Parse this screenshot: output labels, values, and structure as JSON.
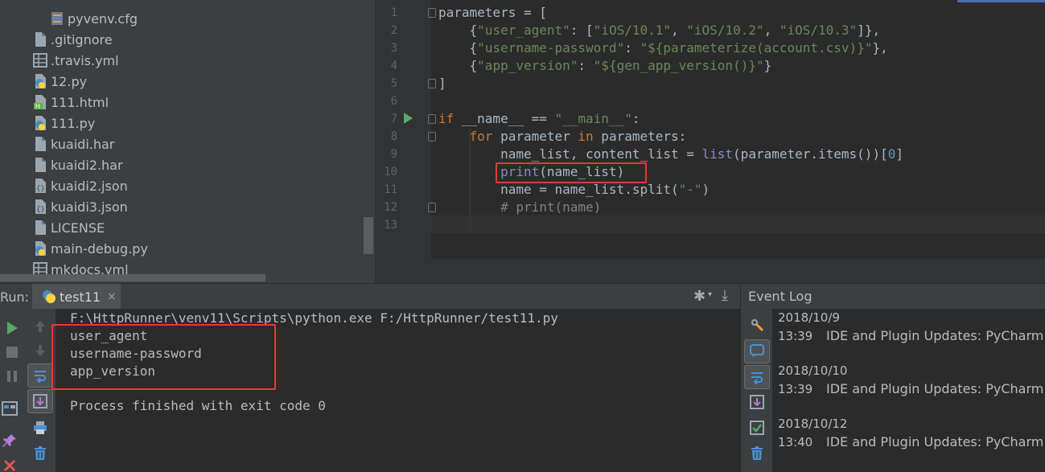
{
  "project_tree": {
    "items": [
      {
        "label": "pyvenv.cfg",
        "icon": "config-file-icon"
      },
      {
        "label": ".gitignore",
        "icon": "text-file-icon"
      },
      {
        "label": ".travis.yml",
        "icon": "yaml-file-icon"
      },
      {
        "label": "12.py",
        "icon": "python-file-icon"
      },
      {
        "label": "111.html",
        "icon": "html-file-icon"
      },
      {
        "label": "111.py",
        "icon": "python-file-icon"
      },
      {
        "label": "kuaidi.har",
        "icon": "text-file-icon"
      },
      {
        "label": "kuaidi2.har",
        "icon": "text-file-icon"
      },
      {
        "label": "kuaidi2.json",
        "icon": "json-file-icon"
      },
      {
        "label": "kuaidi3.json",
        "icon": "json-file-icon"
      },
      {
        "label": "LICENSE",
        "icon": "text-file-icon"
      },
      {
        "label": "main-debug.py",
        "icon": "python-file-icon"
      },
      {
        "label": "mkdocs.yml",
        "icon": "yaml-file-icon"
      }
    ]
  },
  "editor": {
    "line_numbers": [
      "1",
      "2",
      "3",
      "4",
      "5",
      "6",
      "7",
      "8",
      "9",
      "10",
      "11",
      "12",
      "13"
    ],
    "lines": {
      "l1": {
        "a": "parameters = ["
      },
      "l2": {
        "a": "    {",
        "s1": "\"user_agent\"",
        "b": ": [",
        "s2": "\"iOS/10.1\"",
        "c": ", ",
        "s3": "\"iOS/10.2\"",
        "d": ", ",
        "s4": "\"iOS/10.3\"",
        "e": "]},"
      },
      "l3": {
        "a": "    {",
        "s1": "\"username-password\"",
        "b": ": ",
        "s2": "\"${parameterize(account.csv)}\"",
        "e": "},"
      },
      "l4": {
        "a": "    {",
        "s1": "\"app_version\"",
        "b": ": ",
        "s2": "\"${gen_app_version()}\"",
        "e": "}"
      },
      "l5": {
        "a": "]"
      },
      "l7": {
        "k1": "if",
        "a": " __name__ == ",
        "s1": "\"__main__\"",
        "b": ":"
      },
      "l8": {
        "a": "    ",
        "k1": "for",
        "b": " parameter ",
        "k2": "in",
        "c": " parameters:"
      },
      "l9": {
        "a": "        name_list, content_list = ",
        "f1": "list",
        "b": "(parameter.items())[",
        "n1": "0",
        "c": "]"
      },
      "l10": {
        "a": "        ",
        "f1": "print",
        "b": "(name_list)"
      },
      "l11": {
        "a": "        name = name_list.split(",
        "s1": "\"-\"",
        "b": ")"
      },
      "l12": {
        "a": "        ",
        "c1": "# print(name)"
      }
    }
  },
  "run_panel": {
    "label": "Run:",
    "tab_label": "test11",
    "tab_close": "×",
    "gear": "✱",
    "dropdown": "▾",
    "minimize": "⤓",
    "console": {
      "command": "F:\\HttpRunner\\venv11\\Scripts\\python.exe F:/HttpRunner/test11.py",
      "output": [
        "user_agent",
        "username-password",
        "app_version"
      ],
      "exit_message": "Process finished with exit code 0"
    }
  },
  "event_log": {
    "title": "Event Log",
    "entries": [
      {
        "date": "2018/10/9",
        "time": "13:39",
        "message": "IDE and Plugin Updates: PyCharm is"
      },
      {
        "date": "2018/10/10",
        "time": "13:39",
        "message": "IDE and Plugin Updates: PyCharm is"
      },
      {
        "date": "2018/10/12",
        "time": "13:40",
        "message": "IDE and Plugin Updates: PyCharm is"
      }
    ]
  },
  "colors": {
    "editor_bg": "#2b2b2b",
    "panel_bg": "#3c3f41",
    "keyword": "#cc7832",
    "string": "#6a8759",
    "number": "#6897bb",
    "builtin": "#8888c6",
    "comment": "#808080",
    "highlight_box": "#e53935",
    "run_green": "#59a869"
  }
}
